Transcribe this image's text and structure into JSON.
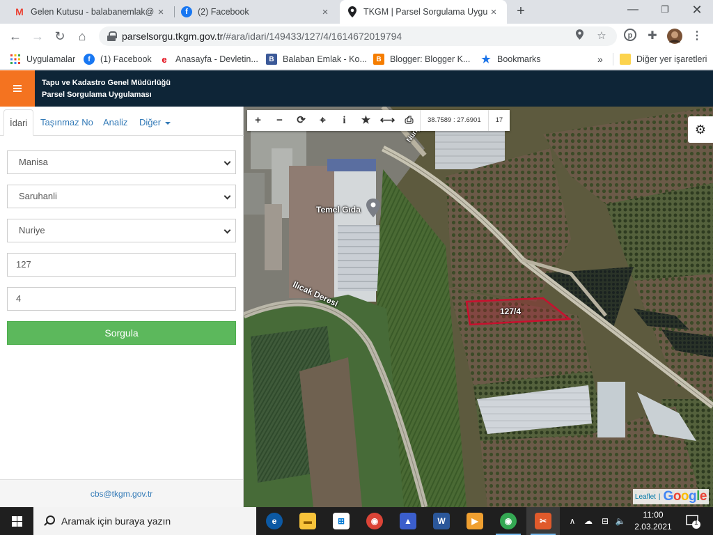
{
  "browser": {
    "tabs": [
      {
        "title": "Gelen Kutusu - balabanemlak@gmail.com",
        "icon": "gmail-icon",
        "active": false
      },
      {
        "title": "(2) Facebook",
        "icon": "facebook-icon",
        "active": false
      },
      {
        "title": "TKGM | Parsel Sorgulama Uygulaması",
        "icon": "location-pin-icon",
        "active": true
      }
    ],
    "url_domain": "parselsorgu.tkgm.gov.tr",
    "url_path": "/#ara/idari/149433/127/4/1614672019794",
    "bookmarks": [
      {
        "label": "Uygulamalar",
        "icon": "apps-grid-icon",
        "color": "#4285f4"
      },
      {
        "label": "(1) Facebook",
        "icon": "facebook-icon",
        "color": "#1877f2"
      },
      {
        "label": "Anasayfa - Devletin...",
        "icon": "edevlet-icon",
        "color": "#e30a17"
      },
      {
        "label": "Balaban Emlak - Ko...",
        "icon": "bookmark-page-icon",
        "color": "#3b5998"
      },
      {
        "label": "Blogger: Blogger K...",
        "icon": "blogger-icon",
        "color": "#f57d00"
      },
      {
        "label": "Bookmarks",
        "icon": "star-icon",
        "color": "#1a73e8"
      }
    ],
    "other_bookmarks": "Diğer yer işaretleri"
  },
  "app": {
    "title_line1": "Tapu ve Kadastro Genel Müdürlüğü",
    "title_line2": "Parsel Sorgulama Uygulaması",
    "accent": "#f47320",
    "header_bg": "#0e2537"
  },
  "panel": {
    "tabs": [
      "İdari",
      "Taşınmaz No",
      "Analiz",
      "Diğer"
    ],
    "active_tab": "İdari",
    "province": "Manisa",
    "district": "Saruhanli",
    "neighborhood": "Nuriye",
    "block": "127",
    "parcel": "4",
    "query_button": "Sorgula",
    "footer_email": "cbs@tkgm.gov.tr"
  },
  "map": {
    "coords": "38.7589 : 27.6901",
    "zoom": "17",
    "parcel_label": "127/4",
    "poi_label": "Temel Gıda",
    "stream_label": "Ilıcak Deresi",
    "road_label": "Nuriye",
    "attribution_leaflet": "Leaflet",
    "attribution_sep": "|",
    "attribution_google": "Google",
    "parcel_color": "#c8102e"
  },
  "taskbar": {
    "search_placeholder": "Aramak için buraya yazın",
    "time": "11:00",
    "date": "2.03.2021",
    "notification_count": "1"
  }
}
